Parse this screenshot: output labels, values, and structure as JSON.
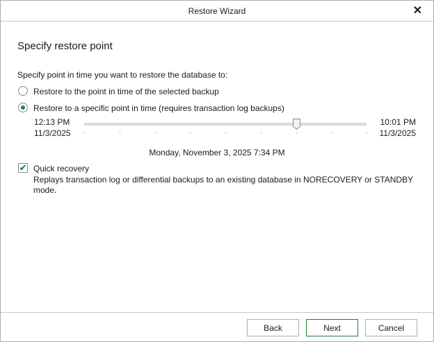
{
  "window": {
    "title": "Restore Wizard"
  },
  "page": {
    "heading": "Specify restore point",
    "prompt": "Specify point in time you want to restore the database to:"
  },
  "options": [
    {
      "label": "Restore to the point in time of the selected backup",
      "selected": false
    },
    {
      "label": "Restore to a specific point in time (requires transaction log backups)",
      "selected": true
    }
  ],
  "slider": {
    "start_time": "12:13 PM",
    "start_date": "11/3/2025",
    "end_time": "10:01 PM",
    "end_date": "11/3/2025",
    "value_fraction": 0.75,
    "tick_count": 9,
    "selected_label": "Monday, November 3, 2025 7:34 PM"
  },
  "quick_recovery": {
    "label": "Quick recovery",
    "checked": true,
    "description": "Replays transaction log or differential backups to an existing database in NORECOVERY or STANDBY mode."
  },
  "buttons": {
    "back": "Back",
    "next": "Next",
    "cancel": "Cancel"
  },
  "colors": {
    "accent": "#1d8a3e"
  }
}
